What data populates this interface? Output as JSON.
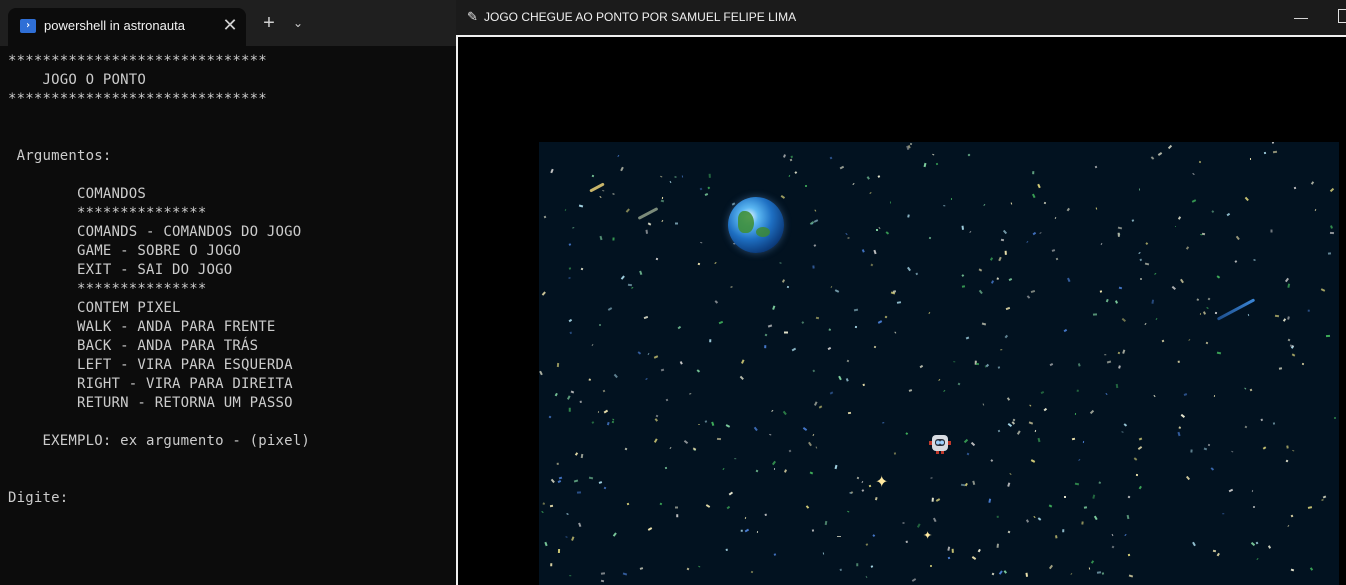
{
  "terminal": {
    "tab_title": "powershell in astronauta",
    "tab_close": "✕",
    "new_tab": "+",
    "dropdown": "⌄",
    "icon": "powershell-icon",
    "lines": [
      "******************************",
      "    JOGO O PONTO",
      "******************************",
      "",
      "",
      " Argumentos:",
      "",
      "        COMANDOS",
      "        ***************",
      "        COMANDS - COMANDOS DO JOGO",
      "        GAME - SOBRE O JOGO",
      "        EXIT - SAI DO JOGO",
      "        ***************",
      "        CONTEM PIXEL",
      "        WALK - ANDA PARA FRENTE",
      "        BACK - ANDA PARA TRÁS",
      "        LEFT - VIRA PARA ESQUERDA",
      "        RIGHT - VIRA PARA DIREITA",
      "        RETURN - RETORNA UM PASSO",
      "",
      "    EXEMPLO: ex argumento - (pixel)",
      "",
      "",
      "Digite:"
    ]
  },
  "game_window": {
    "title": "JOGO CHEGUE AO PONTO POR SAMUEL FELIPE LIMA",
    "icon": "feather-icon",
    "minimize": "—",
    "colors": {
      "canvas_bg": "#021220",
      "frame": "#f0f0f0"
    }
  }
}
